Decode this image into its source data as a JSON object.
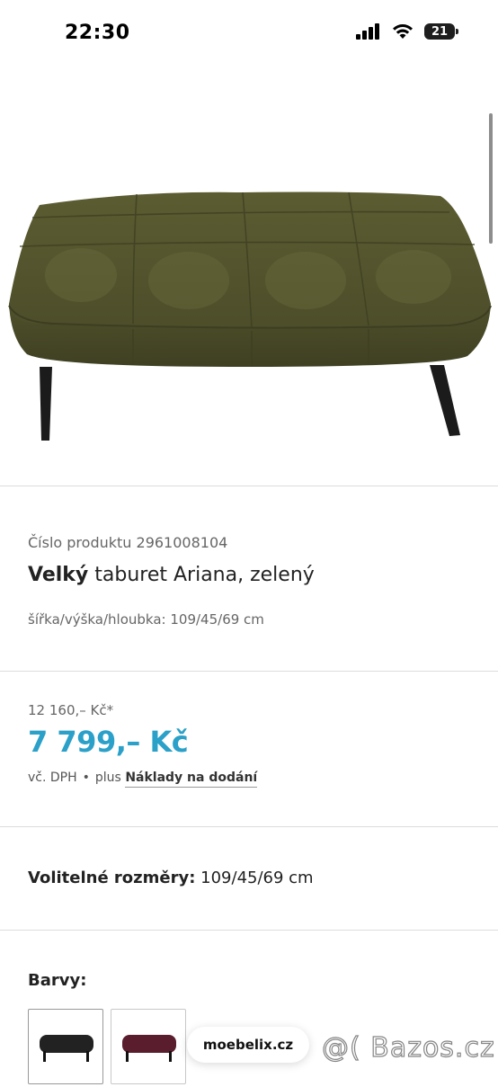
{
  "status_bar": {
    "time": "22:30",
    "battery_level": "21"
  },
  "product": {
    "number_label": "Číslo produktu 2961008104",
    "title_bold": "Velký",
    "title_rest": " taburet Ariana, zelený",
    "dimensions": "šířka/výška/hloubka: 109/45/69 cm",
    "image_icon": "tufted-green-ottoman"
  },
  "pricing": {
    "old_price": "12 160,– Kč*",
    "new_price": "7 799,– Kč",
    "vat_text": "vč. DPH",
    "dot": "•",
    "plus_text": "plus",
    "shipping_link": "Náklady na dodání",
    "price_color": "#2ba0c8"
  },
  "sizes": {
    "label": "Volitelné rozměry:",
    "value": " 109/45/69 cm"
  },
  "colors": {
    "label": "Barvy:",
    "options": [
      {
        "name": "black",
        "color": "#222222"
      },
      {
        "name": "burgundy",
        "color": "#5a1d2e"
      }
    ]
  },
  "browser": {
    "url": "moebelix.cz"
  },
  "watermark": "@( Bazos.cz"
}
